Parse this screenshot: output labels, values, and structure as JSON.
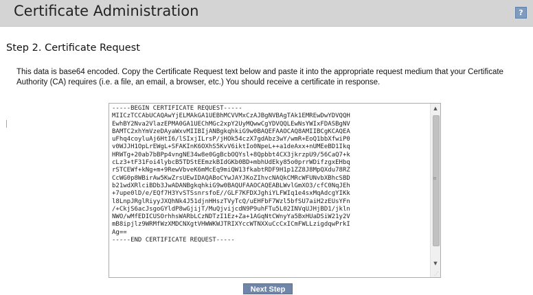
{
  "header": {
    "title": "Certificate Administration",
    "help_label": "?"
  },
  "step": {
    "title": "Step 2. Certificate Request",
    "description": "This data is base64 encoded. Copy the Certificate Request text below and paste it into the appropriate request medium that your Certificate Authority (CA) requires (i.e. a file, an email, a browser, etc.) You should receive a certificate in response."
  },
  "certificate_request": {
    "text": "-----BEGIN CERTIFICATE REQUEST-----\nMIICzTCCAbUCAQAwYjELMAkGA1UEBhMCVVMxCzAJBgNVBAgTAk1EMREwDwYDVQQH\nEwhBY2Nva2VlazEPMA0GA1UEChMGc2xpY2UyMQwwCgYDVQQLEwNsYWIxFDASBgNV\nBAMTC2xhYmVzeDAyaWxvMIIBIjANBgkqhkiG9w0BAQEFAAOCAQ8AMIIBCgKCAQEA\nuFhq4coyluAj6HtI6/lSIxjILrsP/jHOk54czX7gdAbz3wY/wmR+EoQ1bbXfwiP0\nv0WJJH1OpLrEWgL+SFAKInK6OXhS5KvV6iktIo0NpeL++a1deAxx+nUMEeBD1Ikq\nHRWTg+20ab7bBPp4vngNE34w8e0GgBcbOQYsl+8Qpbbt4CX3jkrzpU9/56CaQ7+k\ncLz3+tF31Foi4lybcB5TDStEEmzkBIdGKb0BD+mbhUdEky85o0prrWDifzgxEHbq\nrSTCEWf+kNg+m+9RewVbveK6mMcEq9miQW13fkabtRDF9H1p1ZZ8J8MpQXdu78RZ\nCcWG0p8WBirAw5KwZrsUEwIDAQABoCYwJAYJKoZIhvcNAQkCMRcWFUNvbXBhcSBD\nb21wdXRlciBDb3JwADANBgkqhkiG9w0BAQUFAAOCAQEABLWvlGmXO3/cfC0NqJEh\n+7upe0lD/e/EQf7H3YvSTSsnrsfoE//GLF7KFDXJghiYLFWIq1e4sxMqAdcgYIKk\nl8LnpJRglRiyyJXQhNk4J51djnHHszTVyTcQ/uEHFbF7Wzl5bfSU7aiH2zEUsYFn\n/+CkjS6acJsgoGYldP8wGjijT/MuQjvijcdN9P9uhFTu5L02INVqUJHjBD1/jkln\nNWO/wMfEDICUSOrhhsWARbLCzNDTzI1Ez+Za+1AGqNtCWnyYa5BxHUaDSiW21y2V\nmB8ipjlz9WRMfWzXMDCNXgtVHWWKWJTRIXYccWTNXXuCcCxICmFWLLzigdqwPrkI\nAg==\n-----END CERTIFICATE REQUEST-----"
  },
  "scrollbar": {
    "up_glyph": "▲",
    "down_glyph": "▼",
    "grip_glyph": "≡",
    "resize_glyph": "⋰"
  },
  "actions": {
    "next_label": "Next Step"
  },
  "colors": {
    "title_bar": "#d4d4d4",
    "help_icon": "#7e9bc0",
    "next_button": "#6f86a8"
  }
}
